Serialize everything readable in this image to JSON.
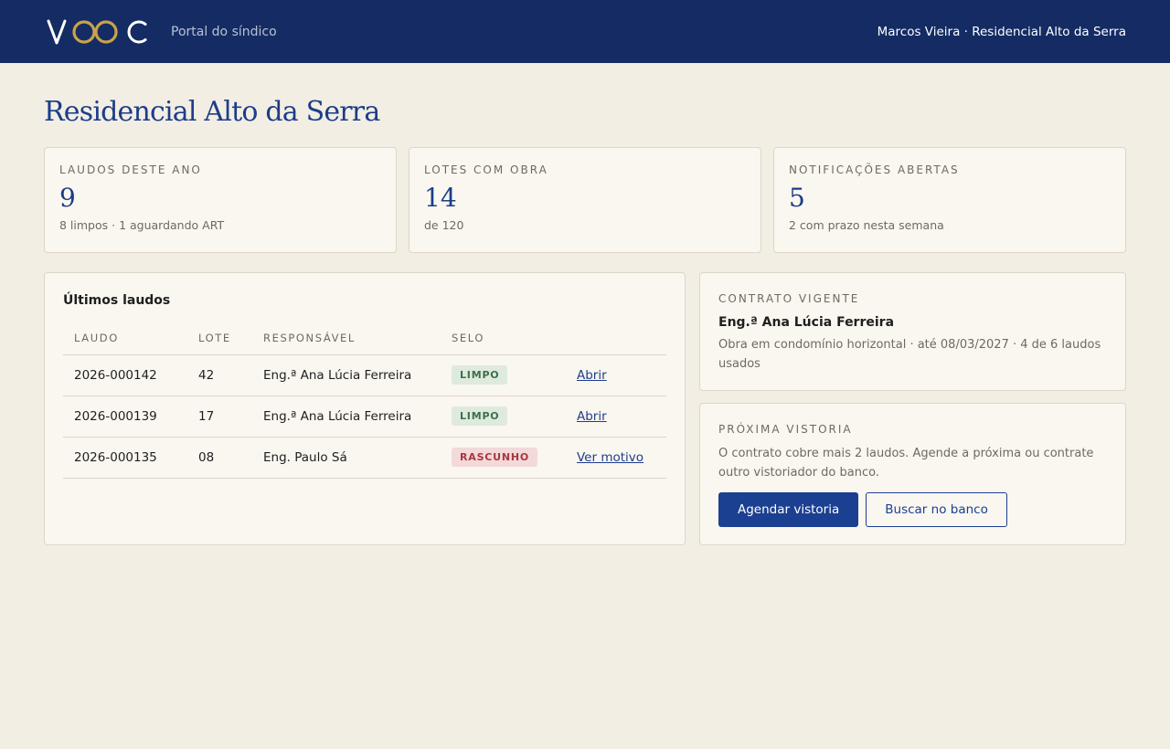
{
  "header": {
    "logo_text": "VOOC",
    "portal_label": "Portal do síndico",
    "user_context": "Marcos Vieira · Residencial Alto da Serra"
  },
  "page": {
    "title": "Residencial Alto da Serra"
  },
  "stats": [
    {
      "label": "LAUDOS DESTE ANO",
      "value": "9",
      "sub": "8 limpos · 1 aguardando ART"
    },
    {
      "label": "LOTES COM OBRA",
      "value": "14",
      "sub": "de 120"
    },
    {
      "label": "NOTIFICAÇÕES ABERTAS",
      "value": "5",
      "sub": "2 com prazo nesta semana"
    }
  ],
  "laudos": {
    "title": "Últimos laudos",
    "columns": [
      "LAUDO",
      "LOTE",
      "RESPONSÁVEL",
      "SELO"
    ],
    "rows": [
      {
        "laudo": "2026-000142",
        "lote": "42",
        "responsavel": "Eng.ª Ana Lúcia Ferreira",
        "selo": "LIMPO",
        "action": "Abrir"
      },
      {
        "laudo": "2026-000139",
        "lote": "17",
        "responsavel": "Eng.ª Ana Lúcia Ferreira",
        "selo": "LIMPO",
        "action": "Abrir"
      },
      {
        "laudo": "2026-000135",
        "lote": "08",
        "responsavel": "Eng. Paulo Sá",
        "selo": "RASCUNHO",
        "action": "Ver motivo"
      }
    ]
  },
  "contract": {
    "label": "CONTRATO VIGENTE",
    "name": "Eng.ª Ana Lúcia Ferreira",
    "desc": "Obra em condomínio horizontal · até 08/03/2027 · 4 de 6 laudos usados"
  },
  "visit": {
    "label": "PRÓXIMA VISTORIA",
    "desc": "O contrato cobre mais 2 laudos. Agende a próxima ou contrate outro vistoriador do banco.",
    "primary_label": "Agendar vistoria",
    "secondary_label": "Buscar no banco"
  },
  "colors": {
    "header_bg": "#142c63",
    "accent": "#1d3d8a",
    "logo_gold": "#c9a24a",
    "badge_ok": "#3c7049",
    "badge_draft": "#a8383d"
  }
}
